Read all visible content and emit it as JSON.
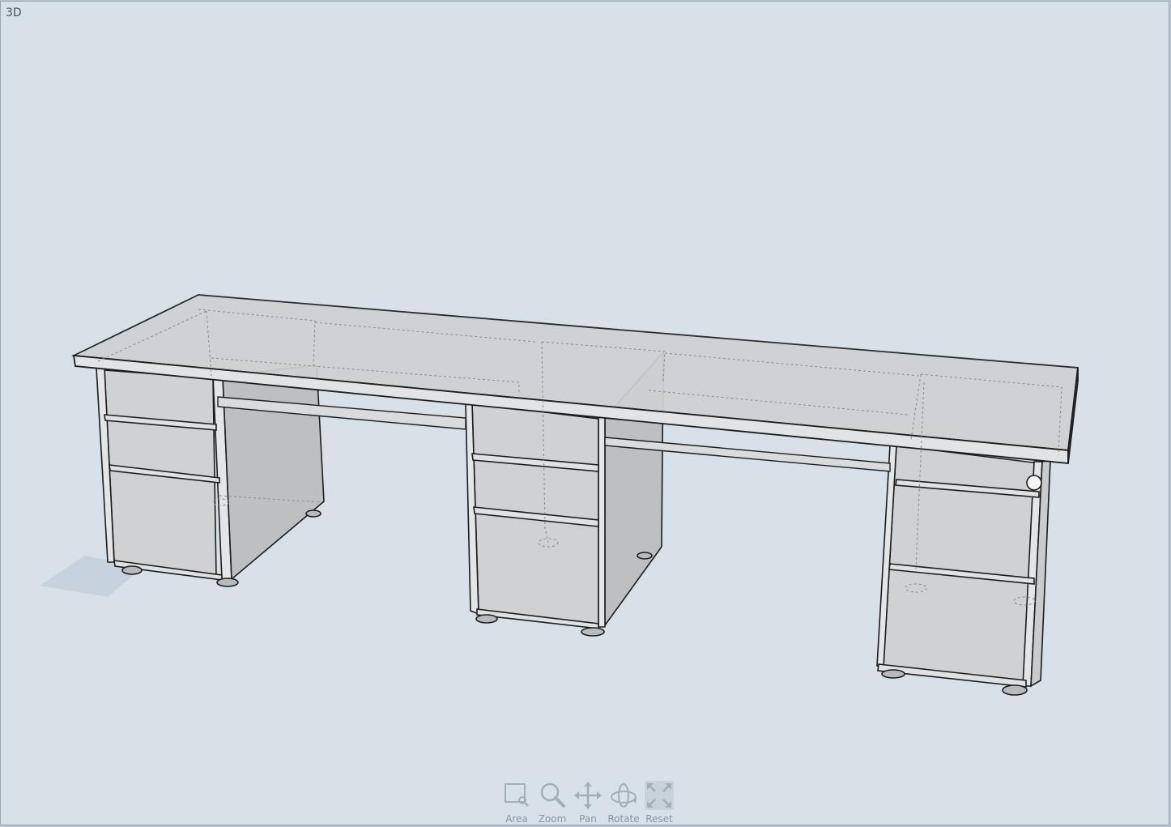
{
  "viewport": {
    "view_label": "3D",
    "background": "#d8e0e8"
  },
  "model": {
    "description_icon": "desk-3d-model",
    "panel_fill": "#d4d6d8",
    "edge_color": "#1c1c1c",
    "hidden_edge_color": "#8a8a8a"
  },
  "toolbar": {
    "tools": [
      {
        "label": "Area",
        "icon": "area-zoom-icon"
      },
      {
        "label": "Zoom",
        "icon": "magnifier-icon"
      },
      {
        "label": "Pan",
        "icon": "pan-arrows-icon"
      },
      {
        "label": "Rotate",
        "icon": "rotate-orbit-icon"
      },
      {
        "label": "Reset",
        "icon": "reset-expand-icon"
      }
    ]
  }
}
